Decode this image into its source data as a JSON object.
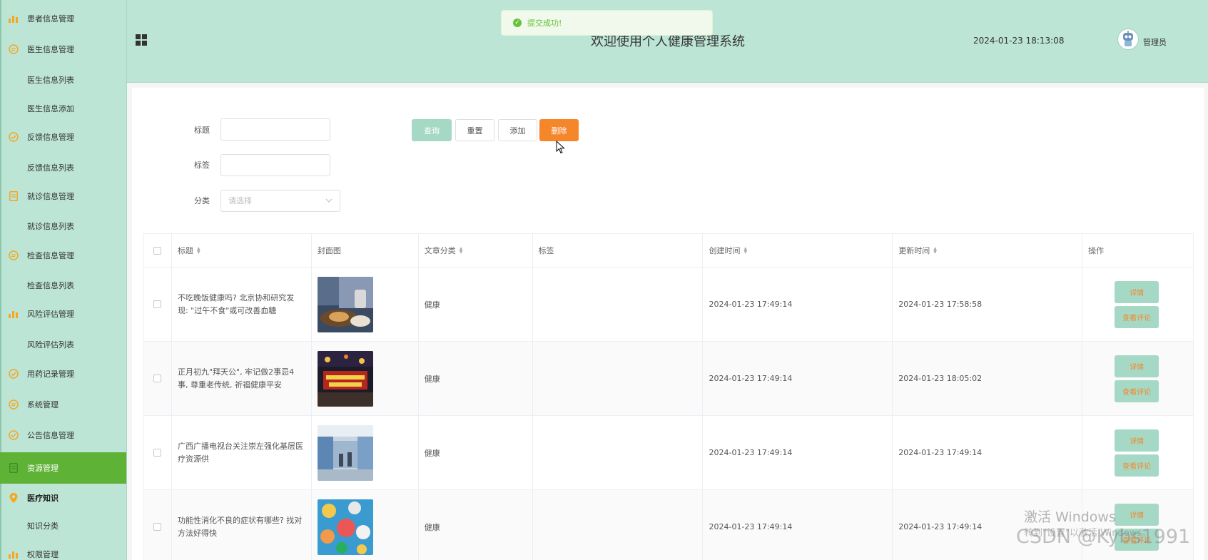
{
  "sidebar": {
    "items": [
      {
        "label": "患者信息管理",
        "icon": "bar-chart-icon"
      },
      {
        "label": "医生信息管理",
        "icon": "chat-icon"
      },
      {
        "label": "医生信息列表"
      },
      {
        "label": "医生信息添加"
      },
      {
        "label": "反馈信息管理",
        "icon": "check-circle-icon"
      },
      {
        "label": "反馈信息列表"
      },
      {
        "label": "就诊信息管理",
        "icon": "document-icon"
      },
      {
        "label": "就诊信息列表"
      },
      {
        "label": "检查信息管理",
        "icon": "chat-icon"
      },
      {
        "label": "检查信息列表"
      },
      {
        "label": "风险评估管理",
        "icon": "bar-chart-icon"
      },
      {
        "label": "风险评估列表"
      },
      {
        "label": "用药记录管理",
        "icon": "check-circle-icon"
      },
      {
        "label": "系统管理",
        "icon": "chat-icon"
      },
      {
        "label": "公告信息管理",
        "icon": "check-circle-icon"
      },
      {
        "label": "资源管理",
        "icon": "document-icon"
      },
      {
        "label": "医疗知识",
        "icon": "location-pin-icon"
      },
      {
        "label": "知识分类"
      },
      {
        "label": "权限管理",
        "icon": "bar-chart-icon"
      }
    ]
  },
  "header": {
    "title": "欢迎使用个人健康管理系统",
    "datetime": "2024-01-23 18:13:08",
    "user": "管理员"
  },
  "toast": {
    "message": "提交成功!"
  },
  "filters": {
    "title_label": "标题",
    "tag_label": "标签",
    "category_label": "分类",
    "category_placeholder": "请选择"
  },
  "buttons": {
    "query": "查询",
    "reset": "重置",
    "add": "添加",
    "delete": "删除"
  },
  "table": {
    "columns": [
      "标题",
      "封面图",
      "文章分类",
      "标签",
      "创建时间",
      "更新时间",
      "操作"
    ],
    "rows": [
      {
        "title": "不吃晚饭健康吗? 北京协和研究发现: \"过午不食\"或可改善血糖",
        "category": "健康",
        "tag": "",
        "created": "2024-01-23 17:49:14",
        "updated": "2024-01-23 17:58:58"
      },
      {
        "title": "正月初九\"拜天公\", 牢记做2事忌4事, 尊重老传统, 祈福健康平安",
        "category": "健康",
        "tag": "",
        "created": "2024-01-23 17:49:14",
        "updated": "2024-01-23 18:05:02"
      },
      {
        "title": "广西广播电视台关注崇左强化基层医疗资源供",
        "category": "健康",
        "tag": "",
        "created": "2024-01-23 17:49:14",
        "updated": "2024-01-23 17:49:14"
      },
      {
        "title": "功能性消化不良的症状有哪些? 找对方法好得快",
        "category": "健康",
        "tag": "",
        "created": "2024-01-23 17:49:14",
        "updated": "2024-01-23 17:49:14"
      }
    ],
    "op_detail": "详情",
    "op_comments": "查看评论"
  },
  "watermarks": {
    "windows": "激活 Windows",
    "windows_sub": "转到\"设置\"以激活 Windows。",
    "csdn": "CSDN @Kybs1991"
  }
}
